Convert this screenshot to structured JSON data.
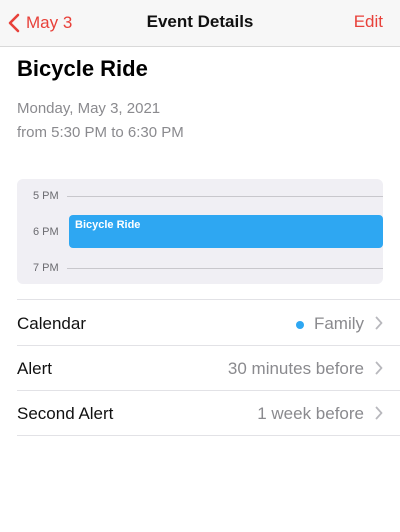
{
  "navbar": {
    "back_label": "May 3",
    "title": "Event Details",
    "edit_label": "Edit"
  },
  "event": {
    "title": "Bicycle Ride",
    "date": "Monday, May 3, 2021",
    "time": "from 5:30 PM to 6:30 PM"
  },
  "timeline": {
    "hours": [
      "5 PM",
      "6 PM",
      "7 PM"
    ],
    "event_label": "Bicycle Ride",
    "event_color": "#2ea7f2"
  },
  "details": {
    "calendar": {
      "label": "Calendar",
      "value": "Family",
      "dot_color": "#2ea7f2"
    },
    "alert": {
      "label": "Alert",
      "value": "30 minutes before"
    },
    "second_alert": {
      "label": "Second Alert",
      "value": "1 week before"
    }
  },
  "colors": {
    "accent": "#e8413a",
    "secondary_text": "#8a8a8e",
    "timeline_bg": "#f0eff4"
  },
  "icons": {
    "back": "chevron-left-icon",
    "disclosure": "chevron-right-icon"
  }
}
